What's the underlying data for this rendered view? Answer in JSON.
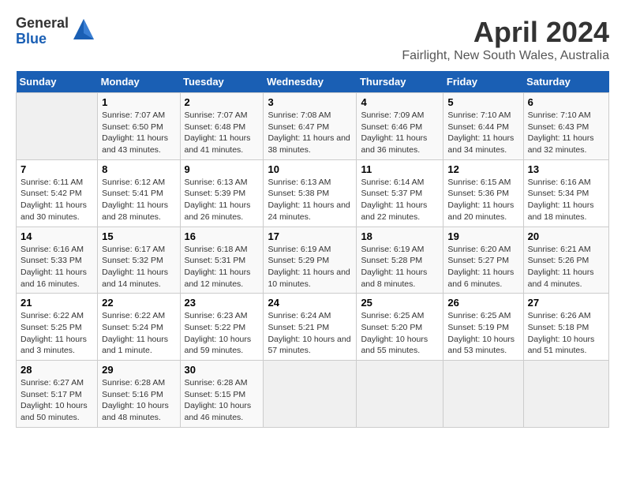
{
  "logo": {
    "general": "General",
    "blue": "Blue"
  },
  "title": "April 2024",
  "subtitle": "Fairlight, New South Wales, Australia",
  "days": [
    "Sunday",
    "Monday",
    "Tuesday",
    "Wednesday",
    "Thursday",
    "Friday",
    "Saturday"
  ],
  "weeks": [
    [
      {
        "date": "",
        "sunrise": "",
        "sunset": "",
        "daylight": ""
      },
      {
        "date": "1",
        "sunrise": "Sunrise: 7:07 AM",
        "sunset": "Sunset: 6:50 PM",
        "daylight": "Daylight: 11 hours and 43 minutes."
      },
      {
        "date": "2",
        "sunrise": "Sunrise: 7:07 AM",
        "sunset": "Sunset: 6:48 PM",
        "daylight": "Daylight: 11 hours and 41 minutes."
      },
      {
        "date": "3",
        "sunrise": "Sunrise: 7:08 AM",
        "sunset": "Sunset: 6:47 PM",
        "daylight": "Daylight: 11 hours and 38 minutes."
      },
      {
        "date": "4",
        "sunrise": "Sunrise: 7:09 AM",
        "sunset": "Sunset: 6:46 PM",
        "daylight": "Daylight: 11 hours and 36 minutes."
      },
      {
        "date": "5",
        "sunrise": "Sunrise: 7:10 AM",
        "sunset": "Sunset: 6:44 PM",
        "daylight": "Daylight: 11 hours and 34 minutes."
      },
      {
        "date": "6",
        "sunrise": "Sunrise: 7:10 AM",
        "sunset": "Sunset: 6:43 PM",
        "daylight": "Daylight: 11 hours and 32 minutes."
      }
    ],
    [
      {
        "date": "7",
        "sunrise": "Sunrise: 6:11 AM",
        "sunset": "Sunset: 5:42 PM",
        "daylight": "Daylight: 11 hours and 30 minutes."
      },
      {
        "date": "8",
        "sunrise": "Sunrise: 6:12 AM",
        "sunset": "Sunset: 5:41 PM",
        "daylight": "Daylight: 11 hours and 28 minutes."
      },
      {
        "date": "9",
        "sunrise": "Sunrise: 6:13 AM",
        "sunset": "Sunset: 5:39 PM",
        "daylight": "Daylight: 11 hours and 26 minutes."
      },
      {
        "date": "10",
        "sunrise": "Sunrise: 6:13 AM",
        "sunset": "Sunset: 5:38 PM",
        "daylight": "Daylight: 11 hours and 24 minutes."
      },
      {
        "date": "11",
        "sunrise": "Sunrise: 6:14 AM",
        "sunset": "Sunset: 5:37 PM",
        "daylight": "Daylight: 11 hours and 22 minutes."
      },
      {
        "date": "12",
        "sunrise": "Sunrise: 6:15 AM",
        "sunset": "Sunset: 5:36 PM",
        "daylight": "Daylight: 11 hours and 20 minutes."
      },
      {
        "date": "13",
        "sunrise": "Sunrise: 6:16 AM",
        "sunset": "Sunset: 5:34 PM",
        "daylight": "Daylight: 11 hours and 18 minutes."
      }
    ],
    [
      {
        "date": "14",
        "sunrise": "Sunrise: 6:16 AM",
        "sunset": "Sunset: 5:33 PM",
        "daylight": "Daylight: 11 hours and 16 minutes."
      },
      {
        "date": "15",
        "sunrise": "Sunrise: 6:17 AM",
        "sunset": "Sunset: 5:32 PM",
        "daylight": "Daylight: 11 hours and 14 minutes."
      },
      {
        "date": "16",
        "sunrise": "Sunrise: 6:18 AM",
        "sunset": "Sunset: 5:31 PM",
        "daylight": "Daylight: 11 hours and 12 minutes."
      },
      {
        "date": "17",
        "sunrise": "Sunrise: 6:19 AM",
        "sunset": "Sunset: 5:29 PM",
        "daylight": "Daylight: 11 hours and 10 minutes."
      },
      {
        "date": "18",
        "sunrise": "Sunrise: 6:19 AM",
        "sunset": "Sunset: 5:28 PM",
        "daylight": "Daylight: 11 hours and 8 minutes."
      },
      {
        "date": "19",
        "sunrise": "Sunrise: 6:20 AM",
        "sunset": "Sunset: 5:27 PM",
        "daylight": "Daylight: 11 hours and 6 minutes."
      },
      {
        "date": "20",
        "sunrise": "Sunrise: 6:21 AM",
        "sunset": "Sunset: 5:26 PM",
        "daylight": "Daylight: 11 hours and 4 minutes."
      }
    ],
    [
      {
        "date": "21",
        "sunrise": "Sunrise: 6:22 AM",
        "sunset": "Sunset: 5:25 PM",
        "daylight": "Daylight: 11 hours and 3 minutes."
      },
      {
        "date": "22",
        "sunrise": "Sunrise: 6:22 AM",
        "sunset": "Sunset: 5:24 PM",
        "daylight": "Daylight: 11 hours and 1 minute."
      },
      {
        "date": "23",
        "sunrise": "Sunrise: 6:23 AM",
        "sunset": "Sunset: 5:22 PM",
        "daylight": "Daylight: 10 hours and 59 minutes."
      },
      {
        "date": "24",
        "sunrise": "Sunrise: 6:24 AM",
        "sunset": "Sunset: 5:21 PM",
        "daylight": "Daylight: 10 hours and 57 minutes."
      },
      {
        "date": "25",
        "sunrise": "Sunrise: 6:25 AM",
        "sunset": "Sunset: 5:20 PM",
        "daylight": "Daylight: 10 hours and 55 minutes."
      },
      {
        "date": "26",
        "sunrise": "Sunrise: 6:25 AM",
        "sunset": "Sunset: 5:19 PM",
        "daylight": "Daylight: 10 hours and 53 minutes."
      },
      {
        "date": "27",
        "sunrise": "Sunrise: 6:26 AM",
        "sunset": "Sunset: 5:18 PM",
        "daylight": "Daylight: 10 hours and 51 minutes."
      }
    ],
    [
      {
        "date": "28",
        "sunrise": "Sunrise: 6:27 AM",
        "sunset": "Sunset: 5:17 PM",
        "daylight": "Daylight: 10 hours and 50 minutes."
      },
      {
        "date": "29",
        "sunrise": "Sunrise: 6:28 AM",
        "sunset": "Sunset: 5:16 PM",
        "daylight": "Daylight: 10 hours and 48 minutes."
      },
      {
        "date": "30",
        "sunrise": "Sunrise: 6:28 AM",
        "sunset": "Sunset: 5:15 PM",
        "daylight": "Daylight: 10 hours and 46 minutes."
      },
      {
        "date": "",
        "sunrise": "",
        "sunset": "",
        "daylight": ""
      },
      {
        "date": "",
        "sunrise": "",
        "sunset": "",
        "daylight": ""
      },
      {
        "date": "",
        "sunrise": "",
        "sunset": "",
        "daylight": ""
      },
      {
        "date": "",
        "sunrise": "",
        "sunset": "",
        "daylight": ""
      }
    ]
  ]
}
